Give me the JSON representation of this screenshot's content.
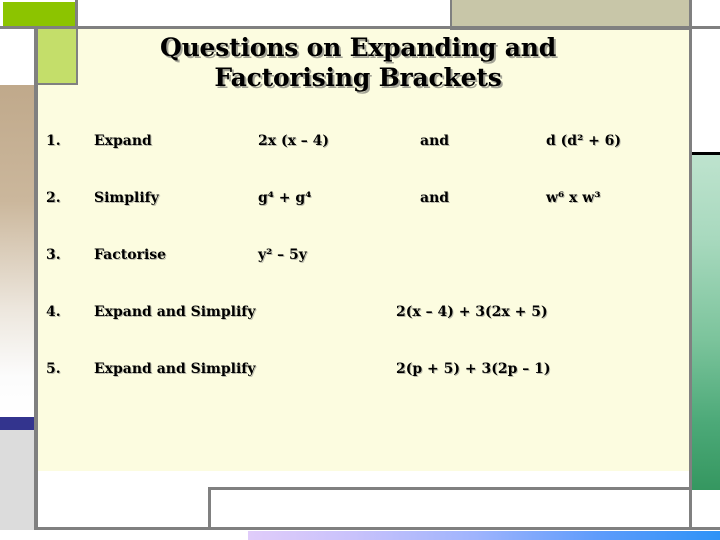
{
  "slide": {
    "title_line1": "Questions on Expanding and",
    "title_line2": "Factorising Brackets",
    "background_color": "#FCFCE0",
    "text_color": "#000000"
  },
  "decorations": {
    "green_top_color": "#8CC400",
    "green_light_color": "#C4DE6A",
    "tan_strip_color": "#C0A98B",
    "blue_bar_color": "#33348E",
    "grey_block_color": "#DCDCDC",
    "khaki_color": "#C8C6A8",
    "green_right_top_color": "#BEE3CE",
    "green_right_bottom_color": "#359760",
    "bottom_bar_left_color": "#E0CCFA",
    "bottom_bar_right_color": "#2E93F7",
    "frame_rule_color": "#808080"
  },
  "questions": [
    {
      "number": "1.",
      "instruction": "Expand",
      "expression": "2x (x – 4)",
      "conjunction": "and",
      "expression2": "d (d² + 6)",
      "wide": false
    },
    {
      "number": "2.",
      "instruction": "Simplify",
      "expression": "g⁴ + g⁴",
      "conjunction": "and",
      "expression2": "w⁶ x w³",
      "wide": false
    },
    {
      "number": "3.",
      "instruction": "Factorise",
      "expression": "y² – 5y",
      "conjunction": "",
      "expression2": "",
      "wide": false
    },
    {
      "number": "4.",
      "instruction": "Expand and Simplify",
      "expression": "2(x – 4) + 3(2x + 5)",
      "conjunction": "",
      "expression2": "",
      "wide": true
    },
    {
      "number": "5.",
      "instruction": "Expand and Simplify",
      "expression": "2(p + 5) + 3(2p – 1)",
      "conjunction": "",
      "expression2": "",
      "wide": true
    }
  ]
}
